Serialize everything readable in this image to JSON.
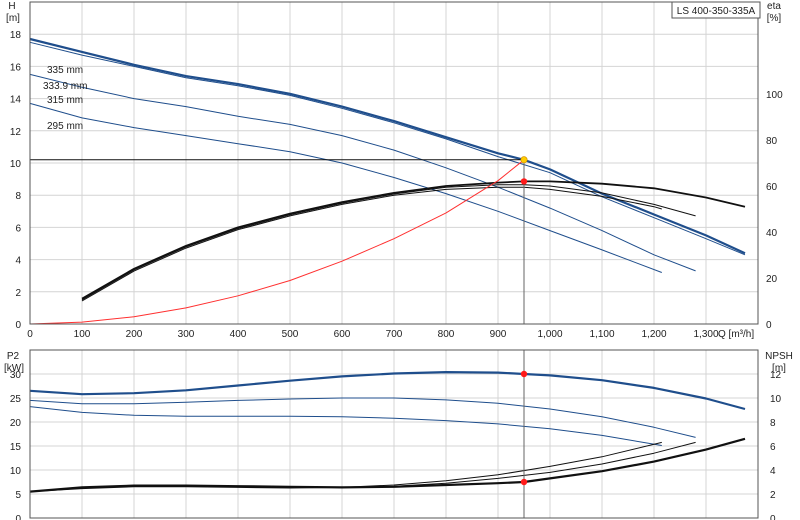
{
  "title": "LS 400-350-335A",
  "colors": {
    "head": "#1f4e8c",
    "efficiency": "#111111",
    "system": "#ff3030",
    "duty_line": "#111111",
    "duty_marker": "#ff1a1a",
    "duty_marker_head": "#ffcc00",
    "grid": "#d4d4d4"
  },
  "chart_data": [
    {
      "type": "line",
      "title": "LS 400-350-335A",
      "xlabel": "Q [m³/h]",
      "ylabel": "H\n[m]",
      "y2label": "eta\n[%]",
      "xlim": [
        0,
        1400
      ],
      "ylim": [
        0,
        20
      ],
      "y2lim": [
        0,
        140
      ],
      "x_ticks": [
        0,
        100,
        200,
        300,
        400,
        500,
        600,
        700,
        800,
        900,
        1000,
        1100,
        1200,
        1300
      ],
      "x_tick_labels": [
        "0",
        "100",
        "200",
        "300",
        "400",
        "500",
        "600",
        "700",
        "800",
        "900",
        "1,000",
        "1,100",
        "1,200",
        "1,300"
      ],
      "y_ticks": [
        0,
        2,
        4,
        6,
        8,
        10,
        12,
        14,
        16,
        18
      ],
      "y2_ticks": [
        0,
        20,
        40,
        60,
        80,
        100
      ],
      "grid": true,
      "series": [
        {
          "name": "335 mm",
          "kind": "head",
          "width": 2.2,
          "x": [
            0,
            100,
            200,
            300,
            400,
            500,
            600,
            700,
            800,
            900,
            950,
            1000,
            1100,
            1200,
            1300,
            1375
          ],
          "y": [
            17.7,
            16.9,
            16.1,
            15.4,
            14.9,
            14.3,
            13.5,
            12.6,
            11.6,
            10.6,
            10.2,
            9.6,
            8.1,
            6.8,
            5.5,
            4.4
          ]
        },
        {
          "name": "333.9 mm",
          "kind": "head",
          "width": 1,
          "x": [
            0,
            100,
            200,
            300,
            400,
            500,
            600,
            700,
            800,
            900,
            1000,
            1100,
            1200,
            1300,
            1375
          ],
          "y": [
            17.5,
            16.7,
            16.0,
            15.3,
            14.8,
            14.2,
            13.4,
            12.5,
            11.5,
            10.4,
            9.4,
            7.9,
            6.6,
            5.3,
            4.3
          ]
        },
        {
          "name": "315 mm",
          "kind": "head",
          "width": 1,
          "x": [
            0,
            100,
            200,
            300,
            400,
            500,
            600,
            700,
            800,
            900,
            1000,
            1100,
            1200,
            1280
          ],
          "y": [
            15.5,
            14.7,
            14.0,
            13.5,
            12.9,
            12.4,
            11.7,
            10.8,
            9.7,
            8.5,
            7.2,
            5.8,
            4.3,
            3.3
          ]
        },
        {
          "name": "295 mm",
          "kind": "head",
          "width": 1,
          "x": [
            0,
            100,
            200,
            300,
            400,
            500,
            600,
            700,
            800,
            900,
            1000,
            1100,
            1215
          ],
          "y": [
            13.7,
            12.8,
            12.2,
            11.7,
            11.2,
            10.7,
            10.0,
            9.1,
            8.1,
            7.0,
            5.8,
            4.6,
            3.2
          ]
        },
        {
          "name": "",
          "kind": "efficiency",
          "width": 1.8,
          "x": [
            100,
            200,
            300,
            400,
            500,
            600,
            700,
            800,
            900,
            950,
            1000,
            1100,
            1200,
            1300,
            1375
          ],
          "y": [
            11,
            24,
            34,
            42,
            48,
            53,
            57,
            60,
            61.5,
            62,
            62,
            61,
            59,
            55,
            51
          ]
        },
        {
          "name": "",
          "kind": "efficiency",
          "width": 1,
          "x": [
            100,
            200,
            300,
            400,
            500,
            600,
            700,
            800,
            900,
            950,
            1000,
            1100,
            1200,
            1280
          ],
          "y": [
            10.5,
            23.5,
            33.5,
            41.5,
            47.5,
            52.5,
            56.5,
            59.5,
            60.5,
            60.5,
            60,
            57,
            52,
            47
          ]
        },
        {
          "name": "",
          "kind": "efficiency",
          "width": 1,
          "x": [
            100,
            200,
            300,
            400,
            500,
            600,
            700,
            800,
            900,
            950,
            1000,
            1100,
            1200,
            1215
          ],
          "y": [
            10,
            23,
            33,
            41,
            47,
            52,
            56,
            58.5,
            59.5,
            59.5,
            58.5,
            55.5,
            51,
            50
          ]
        },
        {
          "name": "",
          "kind": "system",
          "width": 1,
          "x": [
            0,
            100,
            200,
            300,
            400,
            500,
            600,
            700,
            800,
            900,
            950
          ],
          "y": [
            0,
            0.12,
            0.45,
            1.0,
            1.75,
            2.7,
            3.9,
            5.3,
            6.9,
            8.9,
            10.2
          ]
        }
      ],
      "duty_point": {
        "q": 950,
        "h": 10.2,
        "eta": 62
      }
    },
    {
      "type": "line",
      "xlabel": "",
      "ylabel": "P2\n[kW]",
      "y2label": "NPSH\n[m]",
      "xlim": [
        0,
        1400
      ],
      "ylim": [
        0,
        35
      ],
      "y2lim": [
        0,
        14
      ],
      "y_ticks": [
        0,
        5,
        10,
        15,
        20,
        25,
        30
      ],
      "y2_ticks": [
        0,
        2,
        4,
        6,
        8,
        10,
        12
      ],
      "grid": true,
      "series": [
        {
          "name": "",
          "kind": "power",
          "width": 2.2,
          "x": [
            0,
            100,
            200,
            300,
            400,
            500,
            600,
            700,
            800,
            900,
            950,
            1000,
            1100,
            1200,
            1300,
            1375
          ],
          "y": [
            26.5,
            25.8,
            26.0,
            26.6,
            27.6,
            28.6,
            29.5,
            30.1,
            30.4,
            30.3,
            30.0,
            29.7,
            28.7,
            27.1,
            24.9,
            22.7
          ]
        },
        {
          "name": "",
          "kind": "power",
          "width": 1,
          "x": [
            0,
            100,
            200,
            300,
            400,
            500,
            600,
            700,
            800,
            900,
            1000,
            1100,
            1200,
            1280
          ],
          "y": [
            24.5,
            23.8,
            23.8,
            24.1,
            24.5,
            24.8,
            25.0,
            25.0,
            24.6,
            23.9,
            22.7,
            21.1,
            18.9,
            16.8
          ]
        },
        {
          "name": "",
          "kind": "power",
          "width": 1,
          "x": [
            0,
            100,
            200,
            300,
            400,
            500,
            600,
            700,
            800,
            900,
            1000,
            1100,
            1215
          ],
          "y": [
            23.2,
            22.0,
            21.4,
            21.2,
            21.2,
            21.2,
            21.1,
            20.8,
            20.3,
            19.6,
            18.6,
            17.2,
            15.1
          ]
        },
        {
          "name": "",
          "kind": "npsh",
          "width": 2.2,
          "x": [
            0,
            100,
            200,
            300,
            400,
            500,
            600,
            700,
            800,
            900,
            950,
            1000,
            1100,
            1200,
            1300,
            1375
          ],
          "y": [
            2.2,
            2.55,
            2.7,
            2.7,
            2.65,
            2.6,
            2.55,
            2.6,
            2.75,
            2.9,
            3.0,
            3.3,
            3.9,
            4.7,
            5.7,
            6.6
          ]
        },
        {
          "name": "",
          "kind": "npsh",
          "width": 1,
          "x": [
            0,
            100,
            200,
            300,
            400,
            500,
            600,
            700,
            800,
            900,
            1000,
            1100,
            1200,
            1280
          ],
          "y": [
            2.2,
            2.5,
            2.65,
            2.65,
            2.6,
            2.55,
            2.55,
            2.65,
            2.9,
            3.3,
            3.8,
            4.5,
            5.4,
            6.3
          ]
        },
        {
          "name": "",
          "kind": "npsh",
          "width": 1,
          "x": [
            0,
            100,
            200,
            300,
            400,
            500,
            600,
            700,
            800,
            900,
            1000,
            1100,
            1215
          ],
          "y": [
            2.2,
            2.45,
            2.6,
            2.6,
            2.55,
            2.5,
            2.55,
            2.75,
            3.1,
            3.6,
            4.3,
            5.1,
            6.3
          ]
        }
      ],
      "duty_point": {
        "q": 950,
        "p2": 30.0,
        "npsh": 3.0
      }
    }
  ],
  "curve_labels": [
    "335 mm",
    "333.9 mm",
    "315 mm",
    "295 mm"
  ]
}
